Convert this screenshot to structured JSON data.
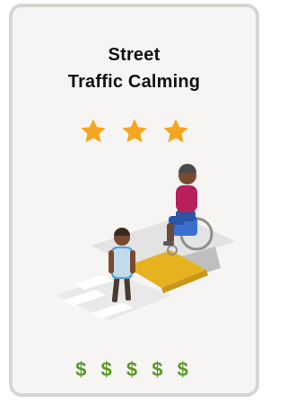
{
  "card": {
    "title_line1": "Street",
    "title_line2": "Traffic Calming",
    "rating": {
      "value": 3,
      "max": 3,
      "icon": "star-icon",
      "color": "#f2a622"
    },
    "cost": {
      "text": "$ $ $ $ $",
      "icon": "dollar-sign",
      "color": "#5a9a27"
    },
    "illustration": {
      "icon": "raised-crosswalk-illustration",
      "colors": {
        "crosswalk": "#e6b21f",
        "pavement": "#d8d8d8",
        "person_shirt": "#4fa3e0",
        "wheelchair_user_shirt": "#b8205a",
        "wheelchair_frame": "#3a6fd0"
      }
    }
  }
}
